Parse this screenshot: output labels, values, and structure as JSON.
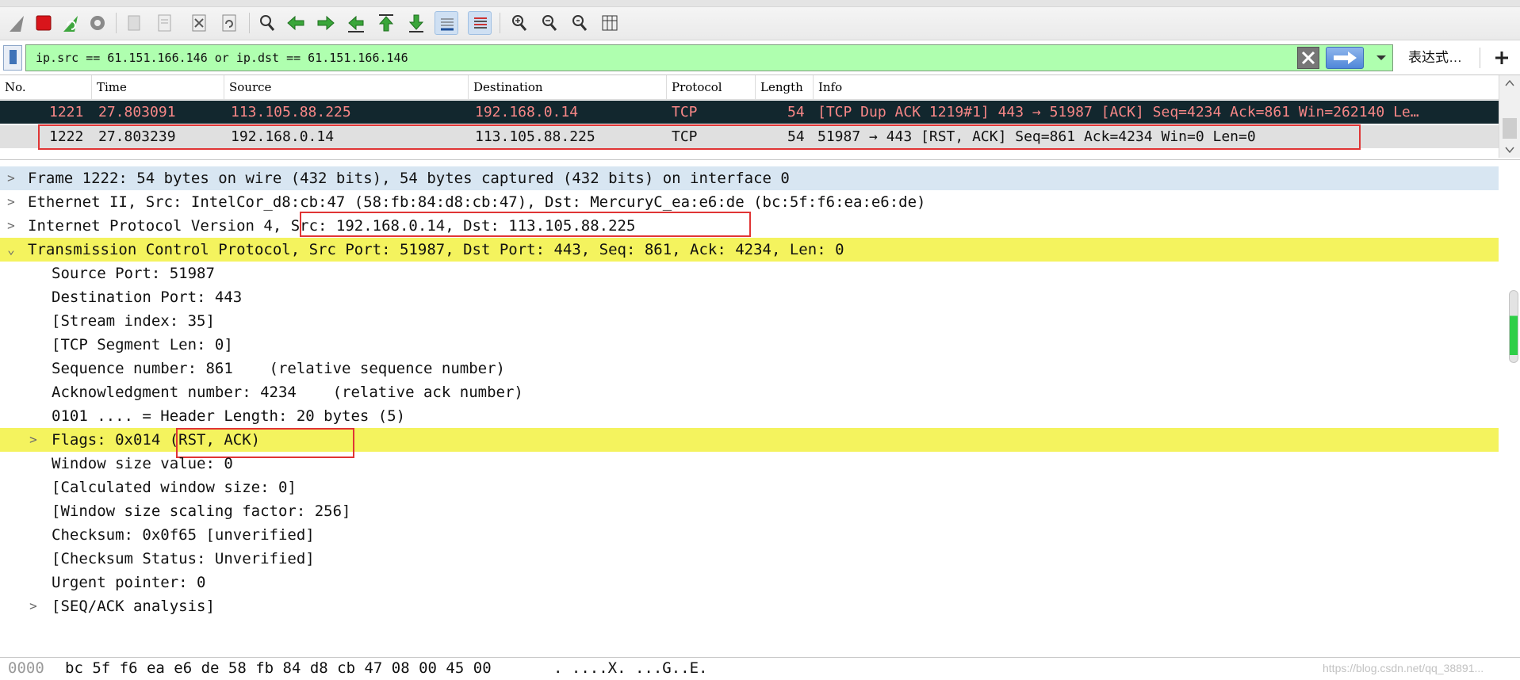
{
  "toolbar": {
    "buttons": [
      {
        "icon": "shark-fin-icon"
      },
      {
        "icon": "stop-capture-icon"
      },
      {
        "icon": "restart-capture-icon"
      },
      {
        "icon": "capture-options-icon"
      },
      {
        "icon": "open-file-icon"
      },
      {
        "icon": "save-file-icon"
      },
      {
        "icon": "close-file-icon"
      },
      {
        "icon": "reload-file-icon"
      },
      {
        "icon": "find-packet-icon"
      },
      {
        "icon": "go-back-icon"
      },
      {
        "icon": "go-forward-icon"
      },
      {
        "icon": "go-to-packet-icon"
      },
      {
        "icon": "go-first-packet-icon"
      },
      {
        "icon": "go-last-packet-icon"
      },
      {
        "icon": "auto-scroll-icon"
      },
      {
        "icon": "colorize-icon"
      },
      {
        "icon": "zoom-in-icon"
      },
      {
        "icon": "zoom-out-icon"
      },
      {
        "icon": "normal-size-icon"
      },
      {
        "icon": "resize-columns-icon"
      }
    ]
  },
  "filter": {
    "value": "ip.src == 61.151.166.146 or ip.dst == 61.151.166.146",
    "expression_label": "表达式…",
    "background_color": "#afffaf"
  },
  "packet_list": {
    "columns": [
      "No.",
      "Time",
      "Source",
      "Destination",
      "Protocol",
      "Length",
      "Info"
    ],
    "rows": [
      {
        "no": "1221",
        "time": "27.803091",
        "source": "113.105.88.225",
        "destination": "192.168.0.14",
        "protocol": "TCP",
        "length": "54",
        "info": "[TCP Dup ACK 1219#1] 443 → 51987 [ACK] Seq=4234 Ack=861 Win=262140 Le…",
        "bg_color": "#12272e",
        "fg_color": "#f78787"
      },
      {
        "no": "1222",
        "time": "27.803239",
        "source": "192.168.0.14",
        "destination": "113.105.88.225",
        "protocol": "TCP",
        "length": "54",
        "info": "51987 → 443 [RST, ACK] Seq=861 Ack=4234 Win=0 Len=0",
        "bg_color": "#e0e0e0",
        "fg_color": "#121212"
      }
    ]
  },
  "details": {
    "frame": "Frame 1222: 54 bytes on wire (432 bits), 54 bytes captured (432 bits) on interface 0",
    "ethernet": "Ethernet II, Src: IntelCor_d8:cb:47 (58:fb:84:d8:cb:47), Dst: MercuryC_ea:e6:de (bc:5f:f6:ea:e6:de)",
    "ip": "Internet Protocol Version 4, Src: 192.168.0.14, Dst: 113.105.88.225",
    "tcp": "Transmission Control Protocol, Src Port: 51987, Dst Port: 443, Seq: 861, Ack: 4234, Len: 0",
    "fields": [
      "Source Port: 51987",
      "Destination Port: 443",
      "[Stream index: 35]",
      "[TCP Segment Len: 0]",
      "Sequence number: 861    (relative sequence number)",
      "Acknowledgment number: 4234    (relative ack number)",
      "0101 .... = Header Length: 20 bytes (5)",
      "Flags: 0x014 (RST, ACK)",
      "Window size value: 0",
      "[Calculated window size: 0]",
      "[Window size scaling factor: 256]",
      "Checksum: 0x0f65 [unverified]",
      "[Checksum Status: Unverified]",
      "Urgent pointer: 0",
      "[SEQ/ACK analysis]"
    ],
    "highlight_color": "#f4f35e"
  },
  "bytes": {
    "offset": "0000",
    "hex": "bc 5f f6 ea e6 de 58 fb  84 d8 cb 47 08 00 45 00",
    "ascii": ". ....X. ...G..E."
  },
  "watermark": "https://blog.csdn.net/qq_38891..."
}
